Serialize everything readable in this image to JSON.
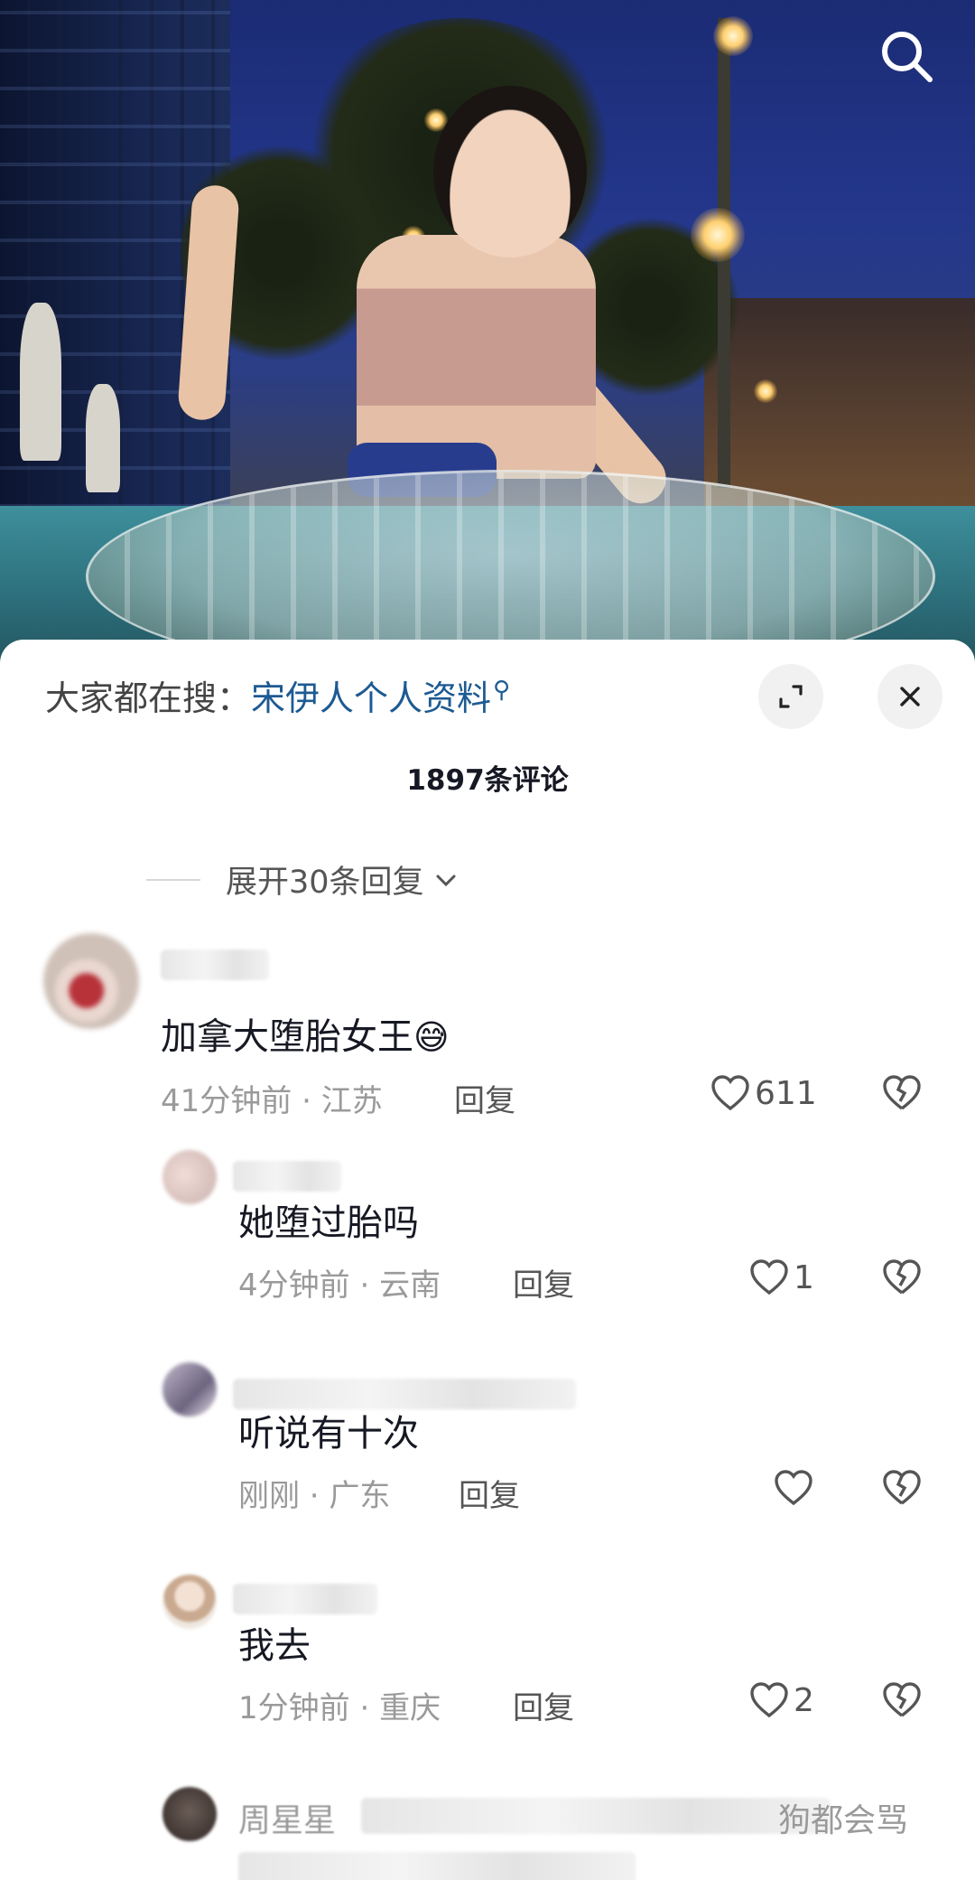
{
  "header": {
    "search_icon": "search-icon"
  },
  "sheet": {
    "search_prefix": "大家都在搜：",
    "search_keyword": "宋伊人个人资料",
    "comment_count": "1897条评论",
    "expand_replies": "展开30条回复"
  },
  "comments": [
    {
      "text": "加拿大堕胎女王",
      "emoji": "😅",
      "time": "41分钟前",
      "location": "江苏",
      "reply": "回复",
      "likes": "611"
    },
    {
      "text": "她堕过胎吗",
      "time": "4分钟前",
      "location": "云南",
      "reply": "回复",
      "likes": "1"
    },
    {
      "text": "听说有十次",
      "time": "刚刚",
      "location": "广东",
      "reply": "回复",
      "likes": ""
    },
    {
      "text": "我去",
      "time": "1分钟前",
      "location": "重庆",
      "reply": "回复",
      "likes": "2"
    }
  ],
  "partial_comment": {
    "username_visible": "周星星",
    "text_visible": "狗都会骂"
  },
  "meta_separator": " · "
}
